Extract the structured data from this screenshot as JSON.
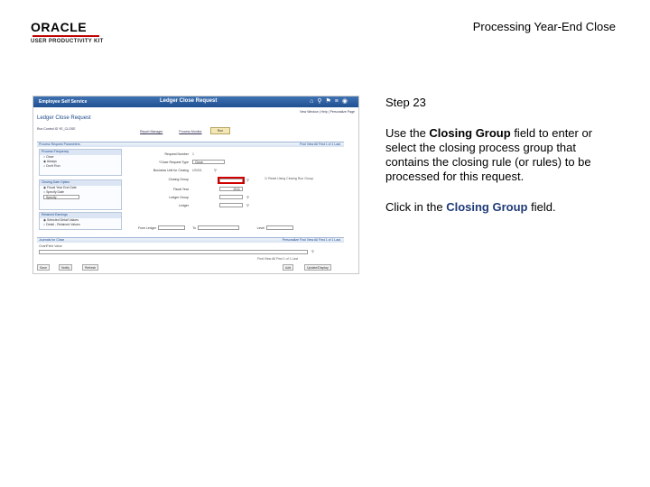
{
  "header": {
    "logo_text": "ORACLE",
    "logo_sub": "USER PRODUCTIVITY KIT",
    "document_title": "Processing Year-End Close"
  },
  "screenshot": {
    "nav_home": "Employee Self Service",
    "page_header": "Ledger Close Request",
    "header_links": "New Window | Help | Personalize Page",
    "page_title": "Ledger Close Request",
    "run_control_line": "Run Control ID  YE_CLOSE",
    "tab_links": [
      "Report Manager",
      "Process Monitor"
    ],
    "run_button": "Run",
    "section1": "Process Request Parameters",
    "section1_nav": "Find  View All    First  1 of 1  Last",
    "process_frequency_header": "Process Frequency",
    "frequency_options": [
      "Once",
      "Always",
      "Don't Run"
    ],
    "request_number_label": "Request Number",
    "request_number_value": "1",
    "close_request_type_label": "*Close Request Type",
    "close_request_type_value": "Close",
    "business_unit_label": "Business Unit for Closing",
    "business_unit_value": "US001",
    "closing_group_label": "Closing Group",
    "fiscal_year_label": "Fiscal Year",
    "fiscal_year_value": "2011",
    "ledger_group_label": "Ledger Group",
    "ledger_label": "Ledger",
    "checkbox_label": "Reset Using Closing Run Group",
    "closing_date_header": "Closing Date Option",
    "closing_date_options": [
      "Fiscal Year End Date",
      "Specify Date"
    ],
    "closing_date_select": "Specify",
    "retained_header": "Retained Earnings",
    "retained_options": [
      "Selected Detail Values",
      "Detail - Retained Values"
    ],
    "from_ledger_label": "From Ledger",
    "to_label": "To",
    "level_label": "Level",
    "section2": "Journals for Close",
    "section2_nav": "Personalize  Find  View All    First  1 of 1  Last",
    "chartfield_label": "ChartField Value",
    "bottom_nav": "Find  View All    First  1 of 1  Last",
    "bottom_buttons": [
      "Save",
      "Notify",
      "Refresh"
    ],
    "bottom_buttons_right": [
      "Add",
      "Update/Display"
    ]
  },
  "instructions": {
    "step": "Step 23",
    "p1_before": "Use the ",
    "p1_bold": "Closing Group",
    "p1_after": " field to enter or select the closing process group that contains the closing rule (or rules) to be processed for this request.",
    "p2_before": "Click in the ",
    "p2_bold": "Closing Group",
    "p2_after": " field."
  }
}
